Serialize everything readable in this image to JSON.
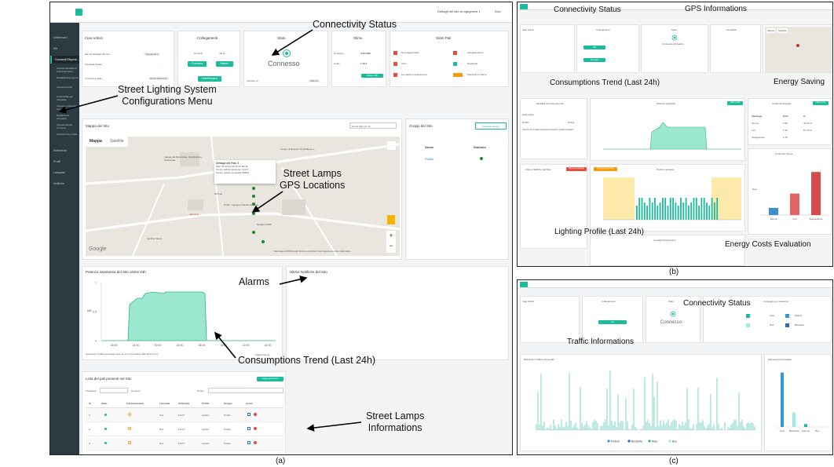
{
  "captions": {
    "a": "(a)",
    "b": "(b)",
    "c": "(c)"
  },
  "annotations": {
    "a": {
      "connectivity": "Connectivity Status",
      "config": "Street Lighting System\nConfigurations Menu",
      "gps": "Street Lamps\nGPS Locations",
      "alarms": "Alarms",
      "trend": "Consumptions Trend (Last 24h)",
      "info": "Street Lamps\nInformations"
    },
    "b": {
      "connectivity": "Connectivity Status",
      "gps": "GPS Informations",
      "trend": "Consumptions Trend (Last 24h)",
      "saving": "Energy Saving",
      "profile": "Lighting Profile (Last 24h)",
      "costs": "Energy Costs Evaluation"
    },
    "c": {
      "connectivity": "Connectivity Status",
      "traffic": "Traffic Informations"
    }
  },
  "a": {
    "header": {
      "right": "Dettagli del sito di ingegneria 1",
      "exit": "Esci"
    },
    "sidebar": [
      {
        "label": "Dashboard",
        "icon": "dashboard-icon"
      },
      {
        "label": "Siti",
        "icon": "building-icon"
      },
      {
        "label": "Comandi Disponibili",
        "icon": "edit-icon",
        "active": true
      },
      {
        "label": "Cambia Modalità di Funzionamento",
        "sub": true
      },
      {
        "label": "Modalità Emergenza",
        "sub": true
      },
      {
        "label": "Imposta Profilo",
        "sub": true
      },
      {
        "label": "Accendi/Spegni Lampade",
        "sub": true
      },
      {
        "label": "Imposta Luminosità Lampade",
        "sub": true
      },
      {
        "label": "Sostituzione Lampade",
        "sub": true
      },
      {
        "label": "Imposta Soglia Corrente",
        "sub": true
      },
      {
        "label": "Imposta Ora e Data",
        "sub": true
      },
      {
        "label": "Statistiche",
        "icon": "chart-icon"
      },
      {
        "label": "Profili",
        "icon": "gear-icon"
      },
      {
        "label": "Lampade",
        "icon": "bulb-icon"
      },
      {
        "label": "Notifiche",
        "icon": "bell-icon"
      }
    ],
    "top": {
      "greeting": "Ciao Admin",
      "site_detail": "Sei nel dettaglio del sito",
      "site_value": "Ingegneria 1",
      "road": "Tipologia Strada",
      "road_value": "-",
      "since": "In funzione dalle",
      "since_value": "18-03-2019 9:07",
      "conn_title": "Collegamenti",
      "from": "Torna al",
      "to": "Vai al",
      "btn1": "Comune",
      "btn2": "Meteo",
      "btn3": "Dashboard",
      "stato": "Stato",
      "connesso": "Connesso",
      "ip_label": "Indirizzo Ip",
      "ip_value": "192.0.0",
      "stime": "Stime",
      "consumo": "Consumo",
      "consumo_val": "0.20 kWh",
      "costo": "Costo",
      "costo_val": "1.26 €",
      "stime_btn": "Ultimo 24h",
      "stato_pali": "Stato Pali",
      "non_raggiungibili": "Non raggiungibili",
      "attivi": "Attivi",
      "in_esaurimento": "Lampada in esaurimento",
      "lampade_rotte": "Lampade Rotte",
      "disattivati": "Disattivati",
      "pacchetti": "Pacchetti Ci Perso",
      "badge_red": "0",
      "badge_green": "1",
      "badge_orange": "0"
    },
    "map": {
      "title": "Mappa del Sito",
      "search": "Cerca Palo per Id",
      "tab_map": "Mappa",
      "tab_sat": "Satellite",
      "popup_title": "Dettagli del Palo 4",
      "popup_l1": "Mac: 00:13:A2:00:41:45:B0:42",
      "popup_l2": "Tempo utilizzo lampada: 13177",
      "popup_l3": "Tempo residuo lampada: 86823",
      "place1": "Ingegneria Meccanica, Energetica e Gestionale",
      "place2": "Centro di Ricerca \"Dimitoffone e...",
      "place3": "MITLab",
      "place4": "DiAM - Ingegneri Gestionale Ass...",
      "place5": "Valentina",
      "place6": "Hangar STAR",
      "place7": "Via Pier Nanni",
      "google": "Google",
      "footer": "Dati mappa ©2019 Google   Termini e condizioni d'uso   Segnala un errore nella mappa"
    },
    "groups": {
      "title": "Gruppi del Sito",
      "btn": "Gestione Gruppi",
      "col1": "Nome",
      "col2": "Simbolo",
      "row": "Profilo"
    },
    "power": {
      "title": "Potenza istantanea del Sito ultime 24h",
      "ylabel": "kW",
      "yticks": [
        "1",
        "0.5",
        "0"
      ],
      "xticks": [
        "18:00",
        "21:00",
        "00:00",
        "03:00",
        "06:00",
        "09:00",
        "12:00",
        "15:00"
      ],
      "note": "Avvertenza: Il grafico può essere vuoto se non vi sono letture nelle ultime 24 ore.",
      "update": "Aggiornato al"
    },
    "notif": {
      "title": "Ultime Notifiche del Sito"
    },
    "table": {
      "title": "Lista dei pali presenti nel Sito",
      "add": "Aggiungi Nuovo",
      "show": "Visualizza",
      "entries": "elementi",
      "search": "Cerca:",
      "headers": [
        "Id",
        "Stato",
        "Funzionamento",
        "Lampada",
        "Utilizzo(h)",
        "Profilo",
        "Gruppo",
        "Azioni"
      ],
      "rows": [
        [
          "1",
          "",
          "",
          "SL1",
          "13177",
          "Aprile1",
          "Profilo",
          ""
        ],
        [
          "2",
          "",
          "",
          "SL1",
          "13177",
          "Aprile1",
          "Profilo",
          ""
        ],
        [
          "4",
          "",
          "",
          "SL1",
          "13177",
          "Aprile1",
          "Profilo",
          ""
        ]
      ]
    }
  },
  "b": {
    "greeting": "Ciao Admin",
    "conn_title": "Collegamenti",
    "stato": "Stato",
    "lampada": "Lampada",
    "connesso": "Connesso al Quadro",
    "btn1": "Vai",
    "btn2": "Gruppo",
    "mode_title": "Modalità di funzionamento",
    "mode_value": "Automatico",
    "profile": "Profilo",
    "profile_value": "Ciclo1",
    "avvertenza": "Avvertenza: il sistema funziona secondo il profilo impostato",
    "trend_title": "Potenza assorbita",
    "trend_btn": "Ultime 24h",
    "saving_title": "Confronto Energie",
    "saving_btn": "Ultime 24h",
    "saving_rows": [
      [
        "Tipologia",
        "Kwh",
        "%"
      ],
      [
        "Senza",
        "0.95",
        "43.62 %"
      ],
      [
        "Led",
        "1.12",
        "57.76 %"
      ],
      [
        "Telegestione",
        "0.78",
        ""
      ]
    ],
    "costs_title": "Confronto Spese",
    "costs_xlabels": [
      "Senza",
      "Led",
      "Telegestione"
    ],
    "costs_ylabel": "Euro",
    "notif_title": "Ultime Notifiche del Palo",
    "notif_btn": "Nessuna Notifica",
    "profile_title": "Profilo impostato",
    "profile_btn": "Programma Orario",
    "energy_title": "Consigli Anticonsumo",
    "map_tab1": "Mappa",
    "map_tab2": "Satellite",
    "costs_values": [
      0.2,
      0.6,
      1.2
    ]
  },
  "c": {
    "greeting": "Ciao Admin",
    "conn_title": "Collegamenti",
    "stato": "Stato",
    "connesso": "Connesso",
    "cat_title": "Conteggio per categorie",
    "btn": "Vai",
    "cats": [
      "Pedoni",
      "Biciclette",
      "Auto",
      "Bus"
    ],
    "traffic_title": "Rilevazioni traffico ultime 24h",
    "legend": [
      "Pedoni",
      "Biciclette",
      "Auto",
      "Bus"
    ],
    "bars_title": "Rilevazioni Cumulative",
    "bars_xlabels": [
      "Auto",
      "Bicicletta",
      "Pedone",
      "Bus"
    ],
    "bars_values": [
      1500,
      400,
      80,
      0
    ]
  },
  "colors": {
    "accent": "#1abc9c",
    "sidebar": "#2c3b41",
    "sidebar_active": "#1e282c",
    "red": "#e74c3c",
    "orange": "#f39c12",
    "green": "#1e8b2a"
  }
}
